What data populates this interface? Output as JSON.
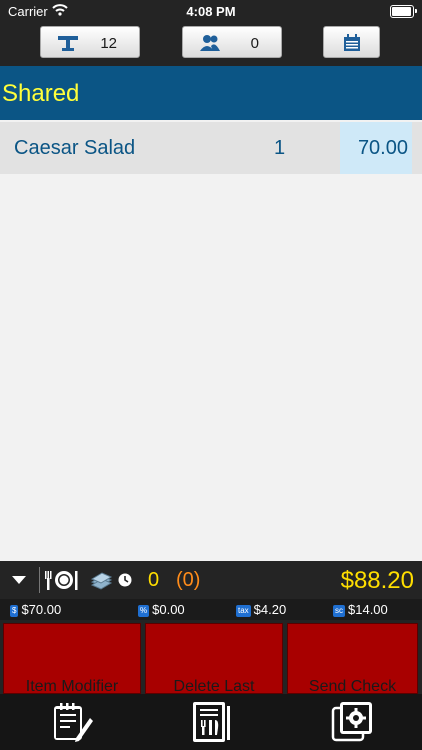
{
  "status": {
    "carrier": "Carrier",
    "time": "4:08 PM"
  },
  "toolbar": {
    "table_number": "12",
    "guest_count": "0"
  },
  "section": {
    "title": "Shared"
  },
  "items": [
    {
      "name": "Caesar Salad",
      "qty": "1",
      "price": "70.00"
    }
  ],
  "totals": {
    "count": "0",
    "pending": "(0)",
    "grand_total": "$88.20"
  },
  "breakdown": {
    "subtotal": "$70.00",
    "subtotal_badge": "$",
    "discount": "$0.00",
    "discount_badge": "%",
    "tax": "$4.20",
    "tax_badge": "tax",
    "service": "$14.00",
    "service_badge": "sc"
  },
  "actions": {
    "item_modifier": "Item Modifier",
    "delete_last": "Delete Last",
    "send_check": "Send Check"
  },
  "colors": {
    "header_blue": "#0b5585",
    "accent_yellow": "#ffde00",
    "action_red": "#a80000"
  }
}
